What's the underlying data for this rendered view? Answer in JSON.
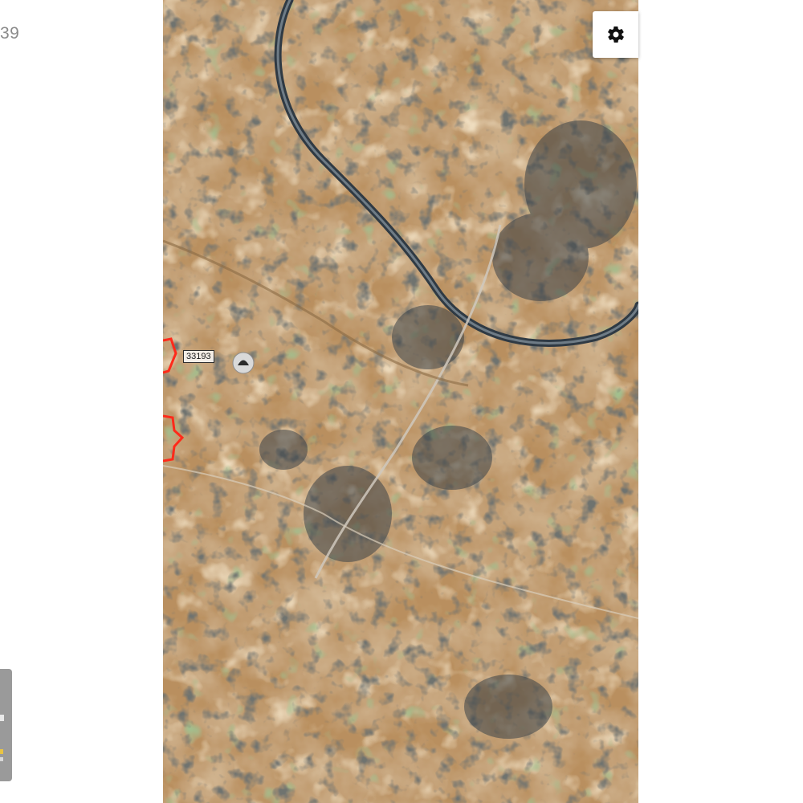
{
  "left_panel": {
    "text": "39"
  },
  "map": {
    "type": "satellite",
    "settings_icon": "gear-icon",
    "parcel_label": "33193",
    "boundary_color": "#ff2a1a"
  }
}
